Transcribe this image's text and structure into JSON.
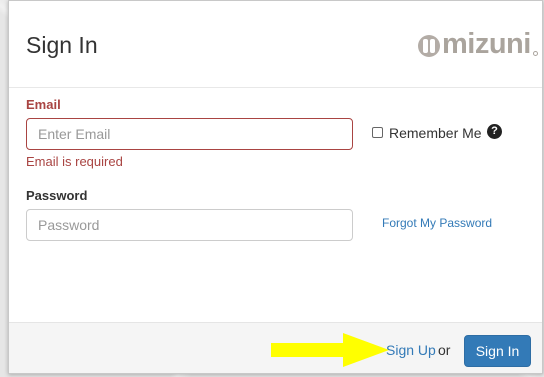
{
  "dialog": {
    "title": "Sign In",
    "logo_text": "mizuni"
  },
  "form": {
    "email_label": "Email",
    "email_placeholder": "Enter Email",
    "email_value": "",
    "email_error": "Email is required",
    "remember_label": "Remember Me",
    "remember_checked": false,
    "help_icon": "?",
    "password_label": "Password",
    "password_placeholder": "Password",
    "password_value": "",
    "forgot_label": "Forgot My Password"
  },
  "footer": {
    "signup_label": "Sign Up",
    "or_text": "or",
    "signin_label": "Sign In"
  },
  "colors": {
    "error": "#a94442",
    "link": "#337ab7",
    "primary": "#337ab7",
    "annotation_arrow": "#ffff00"
  },
  "annotation": {
    "icon": "arrow-right-icon"
  }
}
